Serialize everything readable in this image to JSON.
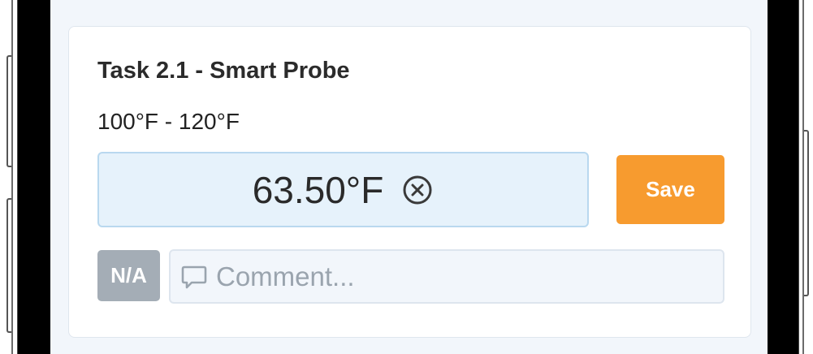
{
  "task": {
    "title": "Task 2.1 - Smart Probe",
    "range": "100°F - 120°F"
  },
  "reading": {
    "value": "63.50°F",
    "clear_icon": "circle-x-icon"
  },
  "actions": {
    "save_label": "Save",
    "na_label": "N/A"
  },
  "comment": {
    "icon": "comment-icon",
    "value": "",
    "placeholder": "Comment..."
  },
  "colors": {
    "save_button": "#f79b2f",
    "na_button": "#a4adb6",
    "reading_background": "#e6f2fb",
    "reading_border": "#b9d8ef",
    "screen_background": "#f2f6fb"
  }
}
